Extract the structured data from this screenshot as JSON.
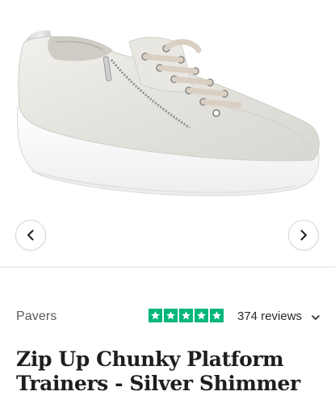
{
  "gallery": {
    "image_alt": "Silver shimmer chunky platform trainer with side zip",
    "prev_icon": "chevron-left-icon",
    "next_icon": "chevron-right-icon"
  },
  "product": {
    "brand": "Pavers",
    "rating_stars": 5,
    "reviews_label": "374 reviews",
    "title_line1": "Zip Up Chunky Platform",
    "title_line2": "Trainers - Silver Shimmer"
  },
  "colors": {
    "trustpilot_green": "#00b67a",
    "text_primary": "#1e1e1e",
    "text_secondary": "#5a5a5a"
  }
}
